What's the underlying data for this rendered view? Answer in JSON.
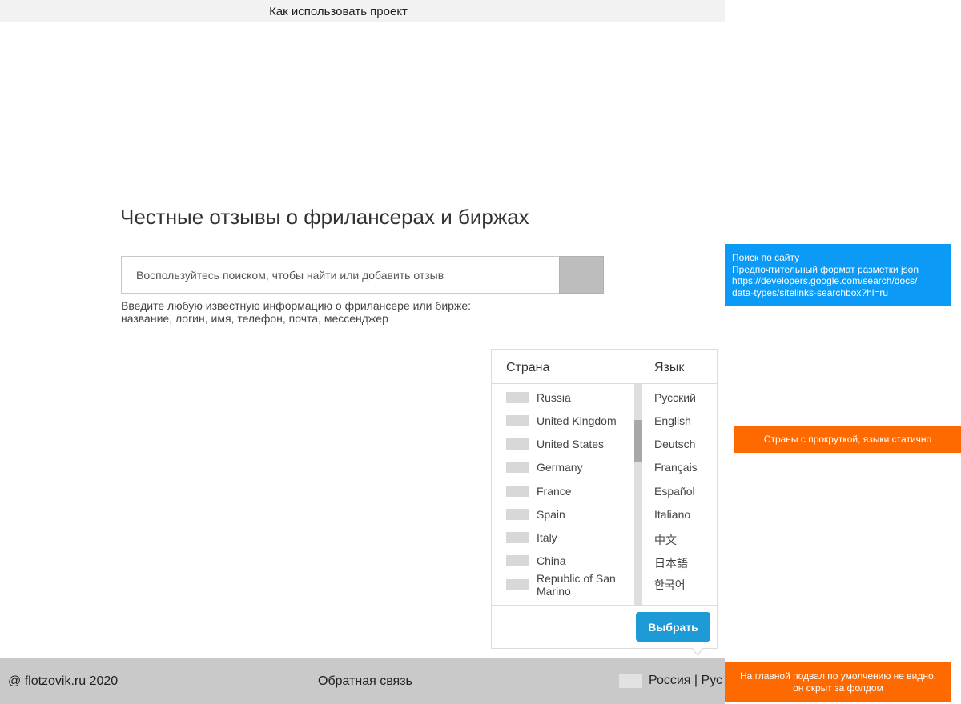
{
  "topbar": {
    "how_to_use": "Как использовать проект"
  },
  "title": "Честные отзывы о фрилансерах и биржах",
  "search": {
    "placeholder": "Воспользуйтесь поиском, чтобы найти или добавить отзыв",
    "value": ""
  },
  "hint": {
    "line1": "Введите любую известную информацию о фрилансере или бирже:",
    "line2": "название, логин, имя, телефон, почта, мессенджер"
  },
  "picker": {
    "country_header": "Страна",
    "language_header": "Язык",
    "countries": [
      "Russia",
      "United Kingdom",
      "United States",
      "Germany",
      "France",
      "Spain",
      "Italy",
      "China",
      "Republic of San",
      "Marino"
    ],
    "languages": [
      "Русский",
      "English",
      "Deutsch",
      "Français",
      "Español",
      "Italiano",
      "中文",
      "日本語",
      "한국어"
    ],
    "choose_label": "Выбрать",
    "scroll_position": 0.2
  },
  "footer": {
    "copyright": "@ flotzovik.ru 2020",
    "feedback": "Обратная связь",
    "region": "Россия | Рус"
  },
  "notes": {
    "search_note": [
      "Поиск по сайту",
      "Предпочтительный формат разметки json",
      "https://developers.google.com/search/docs/",
      "data-types/sitelinks-searchbox?hl=ru"
    ],
    "picker_note": "Страны с прокруткой, языки статично",
    "footer_note": [
      "На главной подвал по умолчению не видно.",
      "он скрыт за фолдом"
    ]
  },
  "colors": {
    "accent_blue": "#1e9ad6",
    "note_blue": "#0b9af5",
    "note_orange": "#ff6a00",
    "footer_bg": "#c9c9c9"
  }
}
